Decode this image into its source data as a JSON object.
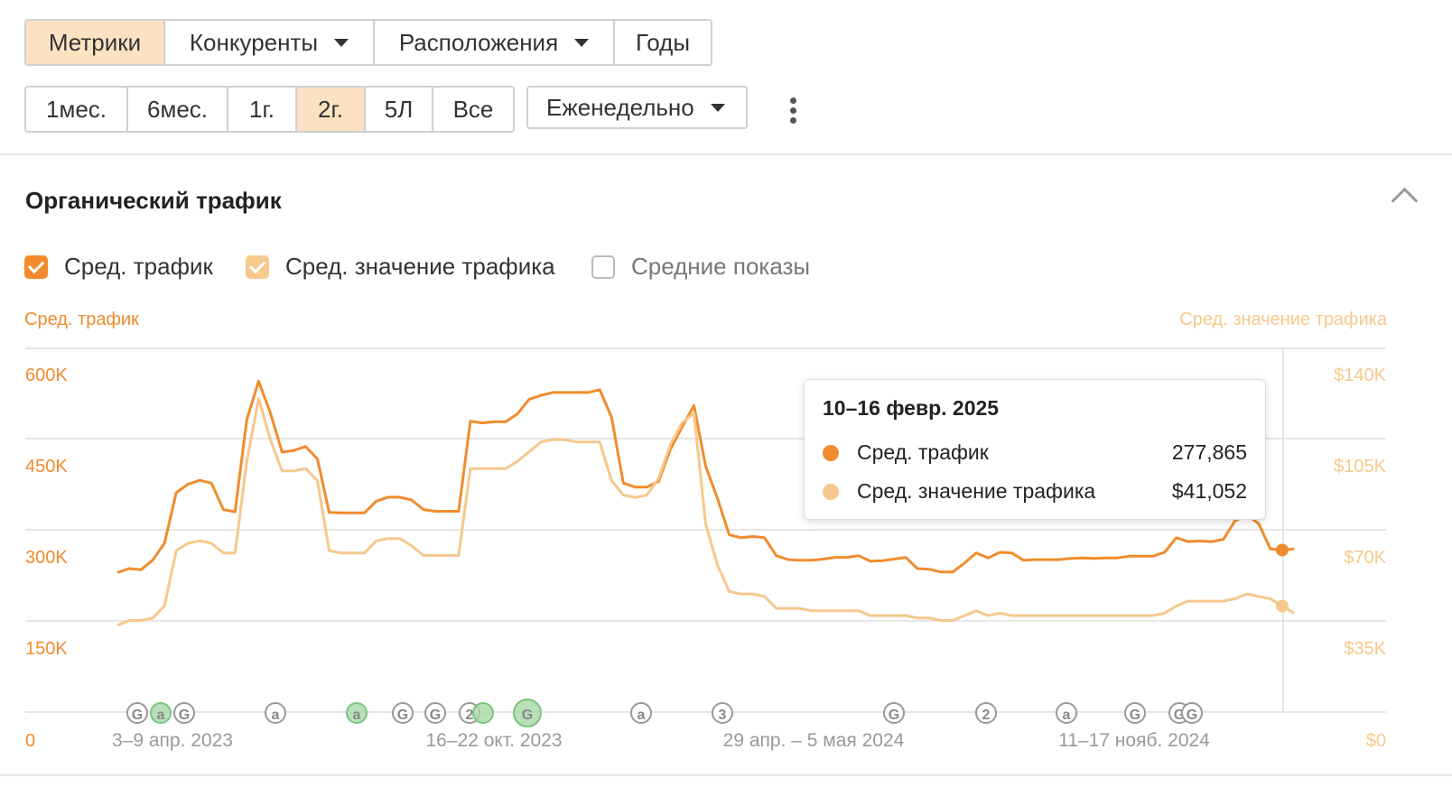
{
  "tabs": [
    {
      "label": "Метрики",
      "active": true,
      "dropdown": false
    },
    {
      "label": "Конкуренты",
      "active": false,
      "dropdown": true
    },
    {
      "label": "Расположения",
      "active": false,
      "dropdown": true
    },
    {
      "label": "Годы",
      "active": false,
      "dropdown": false
    }
  ],
  "ranges": [
    {
      "label": "1мес.",
      "active": false
    },
    {
      "label": "6мес.",
      "active": false
    },
    {
      "label": "1г.",
      "active": false
    },
    {
      "label": "2г.",
      "active": true
    },
    {
      "label": "5Л",
      "active": false
    },
    {
      "label": "Все",
      "active": false
    }
  ],
  "interval": {
    "label": "Еженедельно"
  },
  "section": {
    "title": "Органический трафик"
  },
  "checkboxes": [
    {
      "label": "Сред. трафик",
      "checked": true,
      "color": "#f08c2e"
    },
    {
      "label": "Сред. значение трафика",
      "checked": true,
      "color": "#f7c98d"
    },
    {
      "label": "Средние показы",
      "checked": false,
      "color": "#bbbbbb"
    }
  ],
  "axis_titles": {
    "left": "Сред. трафик",
    "right": "Сред. значение трафика"
  },
  "colors": {
    "traffic": "#f08c2e",
    "value": "#f6c88d",
    "accent": "#fce1c3",
    "tick_left": "#f08c2e",
    "tick_right": "#f7c98d",
    "marker_green": "#7cc47f"
  },
  "tooltip": {
    "title": "10–16 февр. 2025",
    "rows": [
      {
        "label": "Сред. трафик",
        "value": "277,865",
        "color": "#f08c2e"
      },
      {
        "label": "Сред. значение трафика",
        "value": "$41,052",
        "color": "#f6c88d"
      }
    ]
  },
  "chart_data": {
    "type": "line",
    "x_tick_labels": [
      "3–9 апр. 2023",
      "16–22 окт. 2023",
      "29 апр. – 5 мая 2024",
      "11–17 нояб. 2024"
    ],
    "y_left": {
      "ticks": [
        "0",
        "150K",
        "300K",
        "450K",
        "600K"
      ],
      "range": [
        0,
        600000
      ]
    },
    "y_right": {
      "ticks": [
        "$0",
        "$35K",
        "$70K",
        "$105K",
        "$140K"
      ],
      "range": [
        0,
        140000
      ]
    },
    "grid": true,
    "series": [
      {
        "name": "Сред. трафик",
        "axis": "left",
        "values": [
          248000,
          255000,
          253000,
          270000,
          300000,
          390000,
          405000,
          412000,
          407000,
          360000,
          356000,
          520000,
          588000,
          532000,
          462000,
          465000,
          472000,
          450000,
          355000,
          354000,
          354000,
          354000,
          375000,
          382000,
          382000,
          377000,
          360000,
          357000,
          357000,
          357000,
          517000,
          514000,
          516000,
          516000,
          530000,
          556000,
          563000,
          568000,
          568000,
          568000,
          568000,
          573000,
          524000,
          407000,
          400000,
          400000,
          410000,
          467000,
          507000,
          545000,
          437000,
          380000,
          315000,
          310000,
          312000,
          310000,
          278000,
          271000,
          270000,
          270000,
          272000,
          275000,
          275000,
          278000,
          268000,
          269000,
          272000,
          275000,
          255000,
          254000,
          249000,
          249000,
          265000,
          283000,
          274000,
          284000,
          283000,
          270000,
          271000,
          271000,
          271000,
          273000,
          274000,
          273000,
          274000,
          274000,
          277000,
          277000,
          277000,
          284000,
          310000,
          303000,
          304000,
          303000,
          307000,
          340000,
          350000,
          335000,
          290000,
          288000,
          290000
        ]
      },
      {
        "name": "Сред. значение трафика",
        "axis": "right",
        "values": [
          36000,
          38000,
          38000,
          39000,
          44000,
          67000,
          70000,
          71000,
          70000,
          66000,
          66000,
          104000,
          130000,
          113000,
          100000,
          100000,
          101000,
          96000,
          67000,
          66000,
          66000,
          66000,
          71000,
          72000,
          72000,
          69000,
          65000,
          65000,
          65000,
          65000,
          101000,
          101000,
          101000,
          101000,
          104000,
          108000,
          112000,
          113000,
          113000,
          112000,
          112000,
          112000,
          96000,
          90000,
          89000,
          90000,
          97000,
          111000,
          120000,
          124000,
          78000,
          61000,
          50000,
          49000,
          49000,
          48000,
          43000,
          43000,
          43000,
          42000,
          42000,
          42000,
          42000,
          42000,
          40000,
          40000,
          40000,
          40000,
          39000,
          39000,
          38000,
          38000,
          40000,
          42000,
          40000,
          41000,
          40000,
          40000,
          40000,
          40000,
          40000,
          40000,
          40000,
          40000,
          40000,
          40000,
          40000,
          40000,
          40000,
          41000,
          44000,
          46000,
          46000,
          46000,
          46000,
          47000,
          49000,
          48000,
          47000,
          44000,
          41052
        ]
      }
    ],
    "markers": [
      "G",
      "a",
      "G",
      "a",
      "a",
      "G",
      "G",
      "2",
      "",
      "G",
      "a",
      "3",
      "G",
      "2",
      "a",
      "G",
      "G",
      "G"
    ]
  }
}
